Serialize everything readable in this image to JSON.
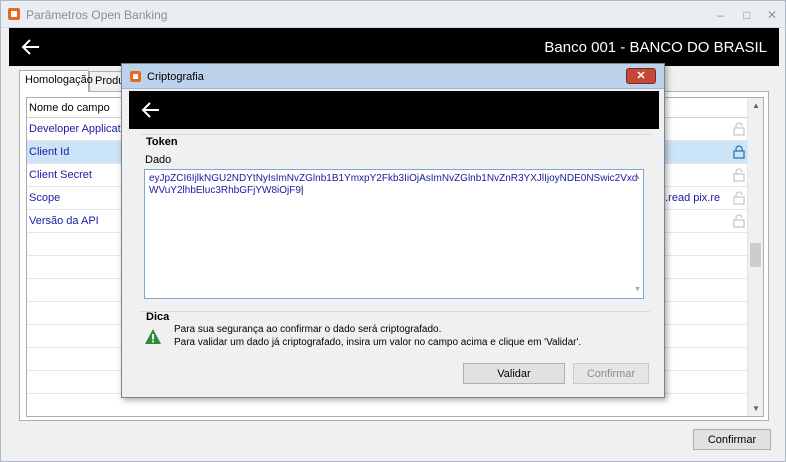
{
  "window": {
    "title": "Parâmetros Open Banking",
    "minimize": "–",
    "maximize": "□",
    "close": "✕"
  },
  "header": {
    "bank_title": "Banco 001 - BANCO DO BRASIL"
  },
  "tabs": [
    {
      "label": "Homologação"
    },
    {
      "label": "Produ"
    }
  ],
  "grid": {
    "column_header": "Nome do campo",
    "rows": [
      {
        "name": "Developer Application",
        "value": "",
        "locked": false
      },
      {
        "name": "Client Id",
        "value": "",
        "locked": true
      },
      {
        "name": "Client Secret",
        "value": "",
        "locked": false
      },
      {
        "name": "Scope",
        "value": "b.read pix.re",
        "locked": false
      },
      {
        "name": "Versão da API",
        "value": "",
        "locked": false
      }
    ]
  },
  "main_buttons": {
    "confirm": "Confirmar"
  },
  "dialog": {
    "title": "Criptografia",
    "close": "✕",
    "token_group": "Token",
    "data_label": "Dado",
    "token_value": "eyJpZCI6IjlkNGU2NDYtNyIsImNvZGlnb1B1YmxpY2Fkb3IiOjAsImNvZGlnb1NvZnR3YXJlIjoyNDE0NSwic2VxdWVuY2lhbEluc3RhbGFjYW8iOjF9",
    "hint_group": "Dica",
    "hint_line1": "Para sua segurança ao confirmar o dado será criptografado.",
    "hint_line2": "Para validar um dado já criptografado, insira um valor no campo acima e clique em 'Validar'.",
    "validate_button": "Validar",
    "confirm_button": "Confirmar"
  },
  "colors": {
    "header_bg": "#000000",
    "selected_row": "#cce4f7",
    "link_text": "#1a1aa0",
    "lock_active": "#2a77b8",
    "lock_inactive": "#c8c8c8",
    "warn_green": "#2e8b3a"
  }
}
